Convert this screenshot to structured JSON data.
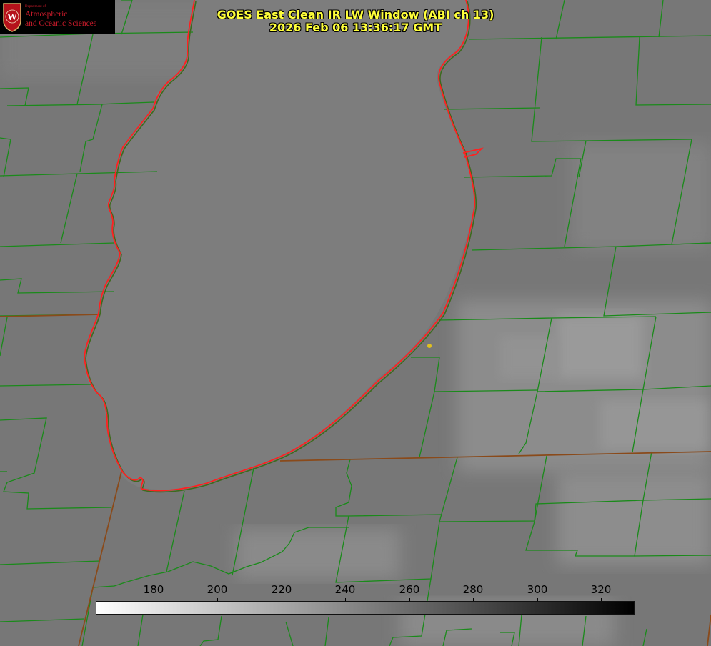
{
  "logo": {
    "dept": "Department of",
    "line1": "Atmospheric",
    "line2": "and Oceanic Sciences",
    "seal_letter": "W",
    "colors": {
      "background": "#000000",
      "text": "#cc1b2b"
    }
  },
  "title": {
    "line1": "GOES East Clean IR LW Window (ABI ch 13)",
    "line2": "2026 Feb 06 13:36:17 GMT",
    "color": "#ffff3a"
  },
  "colorbar": {
    "ticks": [
      "180",
      "200",
      "220",
      "240",
      "260",
      "280",
      "300",
      "320"
    ],
    "colormap": "white-to-black"
  },
  "map": {
    "features": [
      "lake-michigan-shoreline",
      "county-boundaries",
      "state-boundaries",
      "station-marker"
    ],
    "colors": {
      "county_lines": "#1a8a1a",
      "state_lines": "#8a4a1a",
      "shoreline": "#ff2020",
      "marker": "#e0c020",
      "lake": "#7c7c7c",
      "land": "#7a7a7a"
    }
  }
}
